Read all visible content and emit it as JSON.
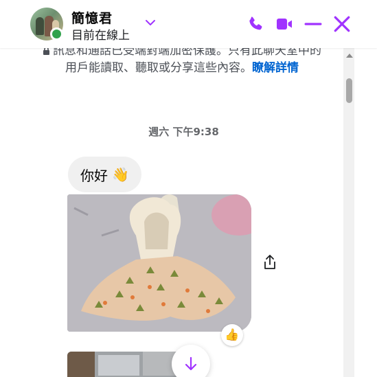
{
  "header": {
    "name": "簡憶君",
    "status": "目前在線上",
    "icons": {
      "menu": "chevron-down-icon",
      "call": "phone-icon",
      "video": "video-camera-icon",
      "minimize": "minimize-icon",
      "close": "close-icon"
    },
    "accent_color": "#a033ff",
    "online_color": "#31a24c"
  },
  "encryption_notice": {
    "text": "訊息和通話已受端對端加密保護。只有此聊天室中的用戶能讀取、聽取或分享這些內容。",
    "link_label": "瞭解詳情"
  },
  "timestamp": "週六 下午9:38",
  "messages": [
    {
      "type": "text",
      "text": "你好",
      "emoji": "👋"
    },
    {
      "type": "image",
      "reaction": "👍"
    },
    {
      "type": "image"
    }
  ]
}
